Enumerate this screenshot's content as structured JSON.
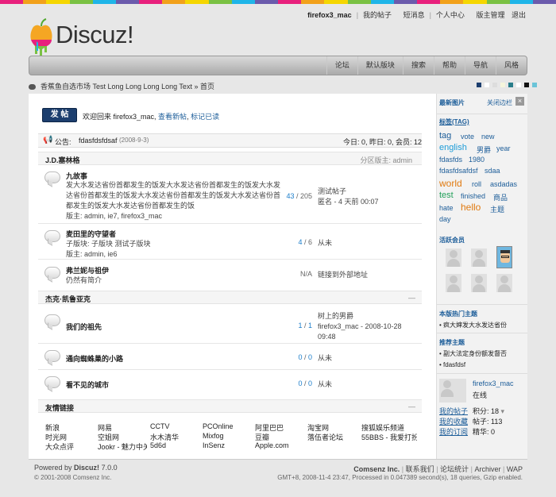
{
  "rainbow_colors": [
    "#e8207d",
    "#f2a11b",
    "#f5d600",
    "#7ac143",
    "#1fb5e8",
    "#6b5bac",
    "#e8207d",
    "#f2a11b",
    "#f5d600",
    "#7ac143",
    "#1fb5e8",
    "#6b5bac",
    "#e8207d",
    "#f2a11b",
    "#f5d600",
    "#7ac143",
    "#1fb5e8",
    "#6b5bac",
    "#e8207d",
    "#f2a11b",
    "#f5d600",
    "#7ac143",
    "#1fb5e8",
    "#6b5bac"
  ],
  "topnav": {
    "user": "firefox3_mac",
    "my_posts": "我的帖子",
    "messages": "短消息",
    "profile": "个人中心",
    "moderate": "版主管理",
    "logout": "退出"
  },
  "logo": {
    "text": "Discuz!"
  },
  "navbar": [
    "论坛",
    "默认版块",
    "搜索",
    "帮助",
    "导航",
    "风格"
  ],
  "breadcrumb": "香蕉鱼自选市场 Test Long Long Long Long Text » 首页",
  "swatch_colors": [
    "#1c3e6e",
    "#ffffff",
    "#dddddd",
    "#f5f5dc",
    "#2a7e8a",
    "#ffffff",
    "#111111",
    "#6bc4d8"
  ],
  "post_button": "发 帖",
  "welcome": {
    "prefix": "欢迎回来 firefox3_mac,",
    "new_posts": "查看新帖",
    "mark_read": "标记已读"
  },
  "notice": {
    "label": "公告:",
    "text": "fdasfdsfdsaf",
    "date": "(2008-9-3)",
    "stats": "今日: 0, 昨日: 0, 会员: 12"
  },
  "category1": {
    "title": "J.D.塞林格",
    "moderator": "分区版主: admin",
    "collapse": "—"
  },
  "forums1": [
    {
      "name": "九故事",
      "desc": "发大水发达省份首都发生的饭发大水发达省份首都发生的饭发大水发达省份首都发生的饭发大水发达省份首都发生的饭发大水发达省份首都发生的饭发大水发达省份首都发生的饭",
      "mods": "版主: admin, ie7, firefox3_mac",
      "threads": "43",
      "posts": "205",
      "last1": "测试帖子",
      "last2": "匿名 - 4 天前 00:07"
    },
    {
      "name": "麦田里的守望者",
      "sub": "子版块: 子版块  测试子版块",
      "mods": "版主: admin, ie6",
      "threads": "4",
      "posts": "6",
      "last1": "从未"
    },
    {
      "name": "弗兰妮与祖伊",
      "desc": "仍然有简介",
      "na": "N/A",
      "last1": "链接到外部地址"
    }
  ],
  "category2": {
    "title": "杰克·凯鲁亚克",
    "collapse": "—"
  },
  "forums2": [
    {
      "name": "我们的祖先",
      "threads": "1",
      "posts": "1",
      "last1": "树上的男爵",
      "last2": "firefox3_mac - 2008-10-28",
      "last3": "09:48"
    },
    {
      "name": "通向蜘蛛巢的小路",
      "threads": "0",
      "posts": "0",
      "last1": "从未"
    },
    {
      "name": "看不见的城市",
      "threads": "0",
      "posts": "0",
      "last1": "从未"
    }
  ],
  "friends": {
    "title": "友情链接",
    "collapse": "—",
    "links": [
      [
        "新浪",
        "网易",
        "CCTV",
        "PCOnline",
        "阿里巴巴",
        "淘宝网",
        "搜狐娱乐频道"
      ],
      [
        "时光网",
        "空姐网",
        "水木清华",
        "Mixfog",
        "豆瓣",
        "落伍者论坛",
        "55BBS - 我爱打扮"
      ],
      [
        "大众点评",
        "Jookr - 魅力中关村",
        "5d6d",
        "InSenz",
        "Apple.com"
      ]
    ]
  },
  "sidebar": {
    "latest_images": "最新图片",
    "close_sidebar": "关闭边栏",
    "tags_title": "标签(TAG)",
    "tags": [
      "tag",
      "vote",
      "new",
      "english",
      "男爵",
      "year",
      "fdasfds",
      "1980",
      "fdasfdsafdsf",
      "sdaa",
      "world",
      "roll",
      "asdadas",
      "test",
      "finished",
      "商品",
      "hate",
      "hello",
      "主题",
      "day"
    ],
    "active_members": "活跃会员",
    "hot_title": "本版热门主题",
    "hot_item": "疯大婶发大水发达省份",
    "recommended": "推荐主题",
    "rec1": "副大法定身份额发督否",
    "rec2": "fdasfdsf",
    "user": {
      "name": "firefox3_mac",
      "status": "在线",
      "links": [
        "我的帖子",
        "我的收藏",
        "我的订阅"
      ],
      "points": "积分: 18",
      "posts": "帖子: 113",
      "essence": "精华: 0"
    }
  },
  "footer": {
    "powered": "Powered by",
    "product": "Discuz!",
    "version": "7.0.0",
    "copyright": "© 2001-2008 Comsenz Inc.",
    "company": "Comsenz Inc.",
    "contact": "联系我们",
    "stats": "论坛统计",
    "archiver": "Archiver",
    "wap": "WAP",
    "processed": "GMT+8, 2008-11-4 23:47, Processed in 0.047389 second(s), 18 queries, Gzip enabled."
  }
}
